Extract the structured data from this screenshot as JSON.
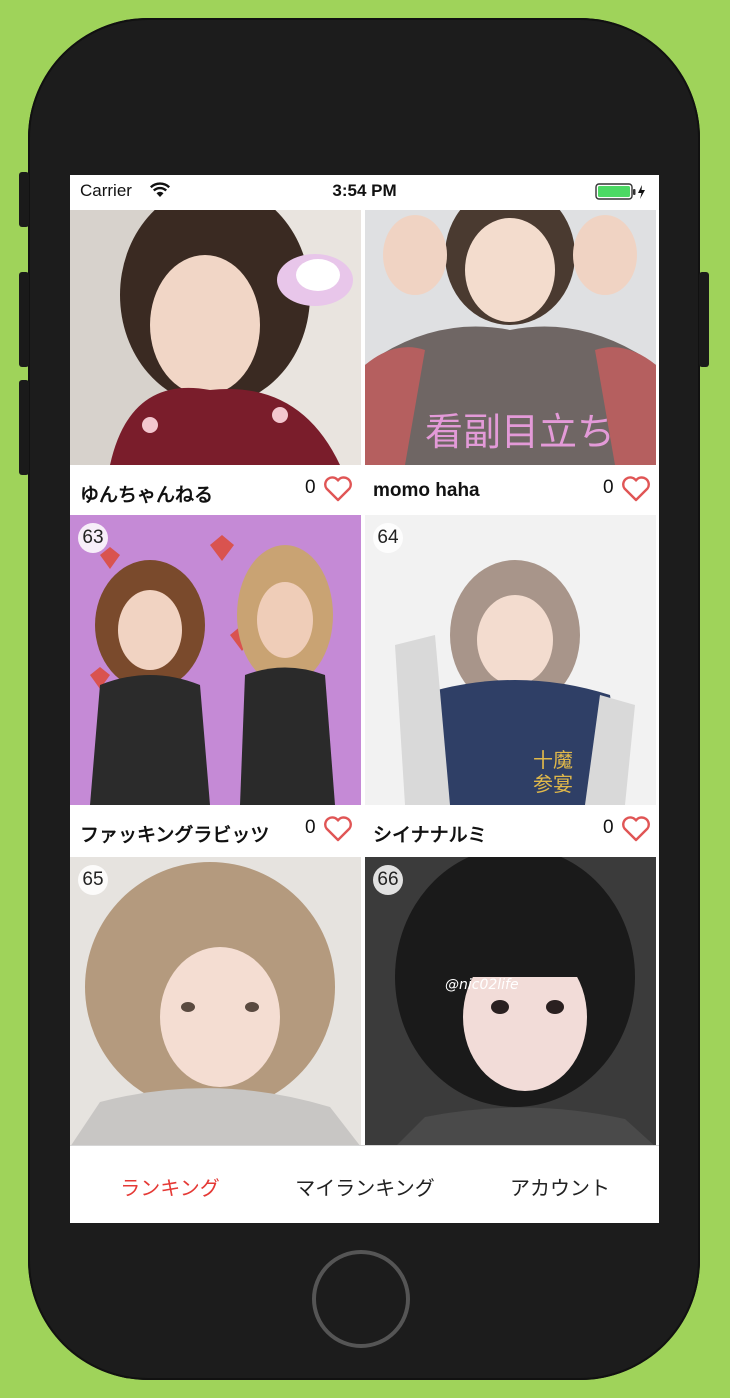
{
  "statusbar": {
    "carrier": "Carrier",
    "time": "3:54 PM"
  },
  "cards": [
    {
      "rank": "",
      "name": "ゆんちゃんねる",
      "likes": "0"
    },
    {
      "rank": "",
      "name": "momo haha",
      "likes": "0"
    },
    {
      "rank": "63",
      "name": "ファッキングラビッツ",
      "likes": "0"
    },
    {
      "rank": "64",
      "name": "シイナナルミ",
      "likes": "0"
    },
    {
      "rank": "65",
      "name": "",
      "likes": ""
    },
    {
      "rank": "66",
      "name": "",
      "likes": ""
    }
  ],
  "tabs": [
    {
      "label": "ランキング",
      "active": true
    },
    {
      "label": "マイランキング",
      "active": false
    },
    {
      "label": "アカウント",
      "active": false
    }
  ],
  "colors": {
    "active_tab": "#e53935",
    "heart": "#e05555",
    "background": "#9fd35a"
  }
}
